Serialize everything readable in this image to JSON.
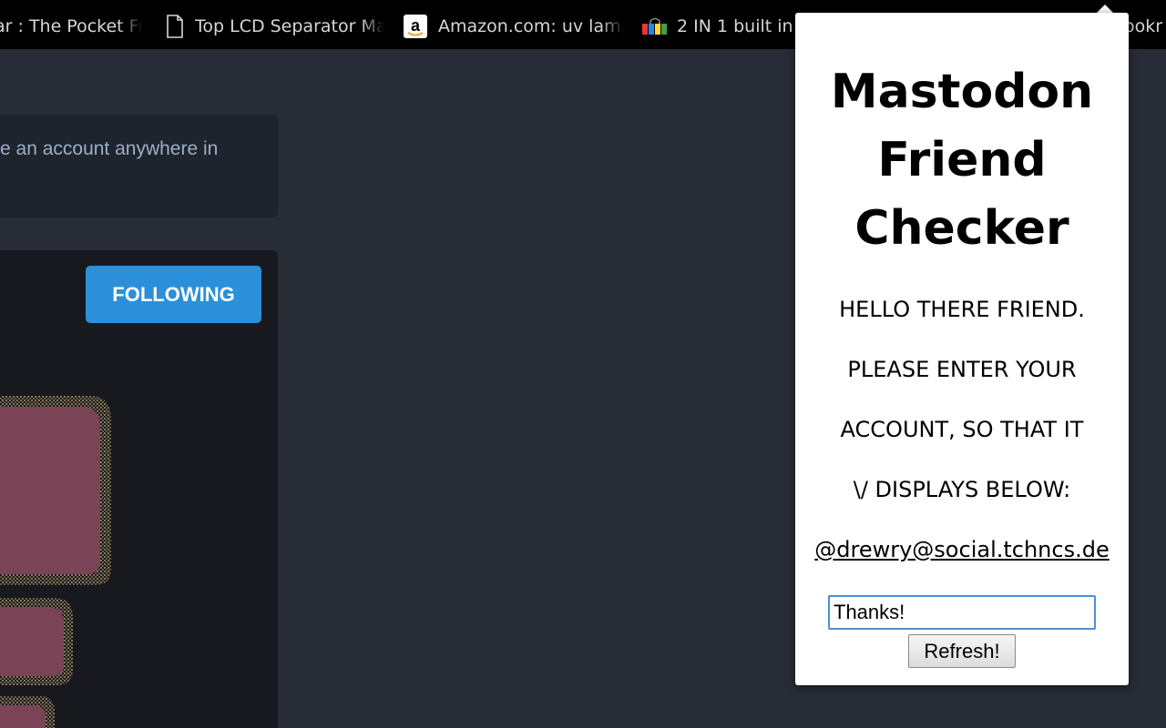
{
  "bookmarks": [
    {
      "label": "ar : The Pocket Fr",
      "icon": "none"
    },
    {
      "label": "Top LCD Separator Ma",
      "icon": "page-icon"
    },
    {
      "label": "Amazon.com: uv lamp",
      "icon": "amazon-icon"
    },
    {
      "label": "2 IN 1 built in",
      "icon": "colorful-shop-icon"
    },
    {
      "label": "ookr",
      "icon": "none"
    }
  ],
  "mastodon": {
    "info_text": "e an account anywhere in",
    "following_label": "FOLLOWING"
  },
  "popup": {
    "title_lines": [
      "Mastodon",
      "Friend",
      "Checker"
    ],
    "message_lines": [
      "HELLO THERE FRIEND.",
      "PLEASE ENTER YOUR",
      "ACCOUNT, SO THAT IT",
      "\\/ DISPLAYS BELOW:"
    ],
    "account": "@drewry@social.tchncs.de",
    "input_value": "Thanks!",
    "refresh_label": "Refresh!"
  },
  "colors": {
    "page_background": "#282c37",
    "card_background": "#1f232b",
    "following_button": "#2b90d9",
    "avatar_fill": "#7a4456"
  }
}
